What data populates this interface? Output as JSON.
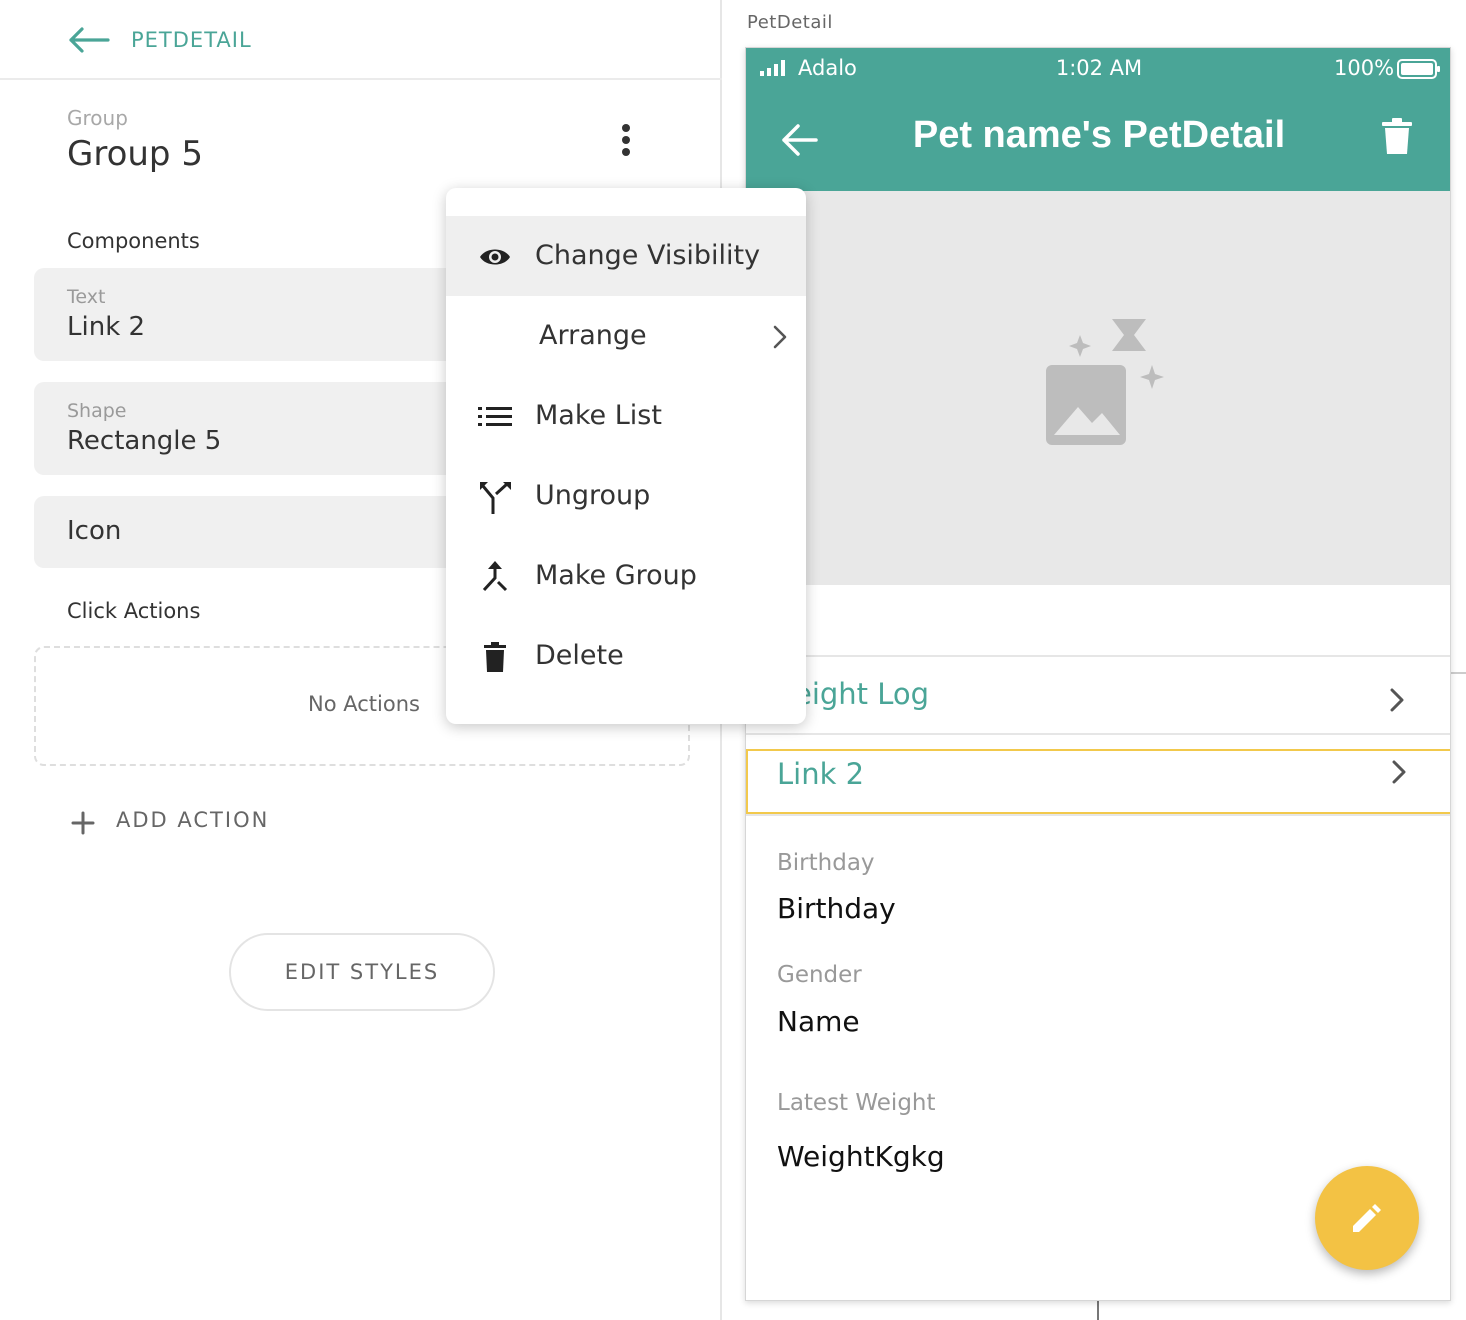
{
  "colors": {
    "brand": "#4aa597",
    "selection": "#f2c94c",
    "fab": "#f3c244"
  },
  "left_panel": {
    "back_label": "PETDETAIL",
    "group_caption": "Group",
    "group_title": "Group 5",
    "components_label": "Components",
    "components": [
      {
        "caption": "Text",
        "value": "Link 2"
      },
      {
        "caption": "Shape",
        "value": "Rectangle 5"
      },
      {
        "caption": "",
        "value": "Icon"
      }
    ],
    "click_actions_label": "Click Actions",
    "no_actions": "No Actions",
    "add_action": "ADD ACTION",
    "edit_styles": "EDIT STYLES"
  },
  "context_menu": {
    "items": [
      {
        "label": "Change Visibility",
        "icon": "eye-icon"
      },
      {
        "label": "Arrange",
        "icon": "chevron-right-icon"
      },
      {
        "label": "Make List",
        "icon": "list-icon"
      },
      {
        "label": "Ungroup",
        "icon": "ungroup-icon"
      },
      {
        "label": "Make Group",
        "icon": "merge-icon"
      },
      {
        "label": "Delete",
        "icon": "trash-icon"
      }
    ]
  },
  "canvas": {
    "screen_label": "PetDetail",
    "status": {
      "carrier": "Adalo",
      "time": "1:02 AM",
      "battery": "100%"
    },
    "header_title": "Pet name's PetDetail",
    "rows": [
      {
        "label": "eight Log"
      },
      {
        "label": "Link 2"
      }
    ],
    "fields": [
      {
        "caption": "Birthday",
        "value": "Birthday"
      },
      {
        "caption": "Gender",
        "value": "Name"
      },
      {
        "caption": "Latest Weight",
        "value": "WeightKgkg"
      }
    ]
  }
}
